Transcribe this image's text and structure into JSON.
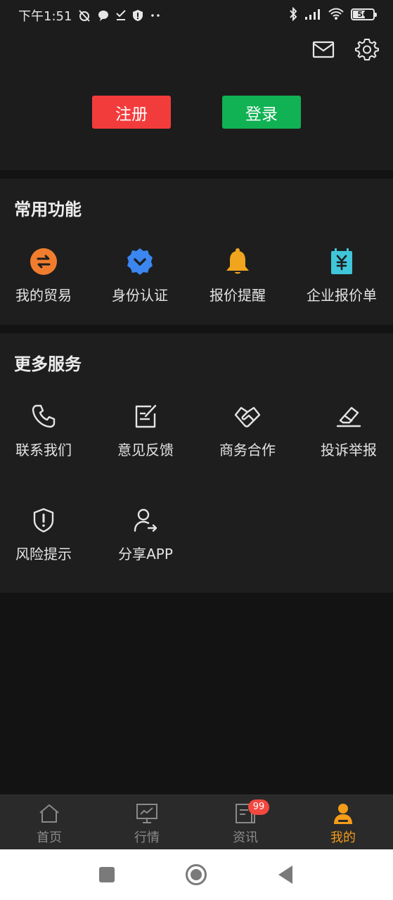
{
  "status_bar": {
    "time": "下午1:51",
    "battery": "56"
  },
  "header": {
    "register_label": "注册",
    "login_label": "登录"
  },
  "common": {
    "title": "常用功能",
    "items": [
      {
        "label": "我的贸易",
        "icon": "exchange-icon"
      },
      {
        "label": "身份认证",
        "icon": "verified-badge-icon"
      },
      {
        "label": "报价提醒",
        "icon": "bell-icon"
      },
      {
        "label": "企业报价单",
        "icon": "yen-document-icon"
      }
    ]
  },
  "more": {
    "title": "更多服务",
    "items": [
      {
        "label": "联系我们",
        "icon": "phone-icon"
      },
      {
        "label": "意见反馈",
        "icon": "edit-note-icon"
      },
      {
        "label": "商务合作",
        "icon": "handshake-icon"
      },
      {
        "label": "投诉举报",
        "icon": "eraser-icon"
      },
      {
        "label": "风险提示",
        "icon": "shield-alert-icon"
      },
      {
        "label": "分享APP",
        "icon": "user-share-icon"
      }
    ]
  },
  "tabs": [
    {
      "label": "首页",
      "icon": "home-icon"
    },
    {
      "label": "行情",
      "icon": "chart-board-icon"
    },
    {
      "label": "资讯",
      "icon": "news-icon",
      "badge": "99"
    },
    {
      "label": "我的",
      "icon": "profile-icon",
      "active": true
    }
  ],
  "colors": {
    "register": "#f23c3c",
    "login": "#10b253",
    "active_tab": "#f39c1a",
    "badge": "#f2483f"
  }
}
